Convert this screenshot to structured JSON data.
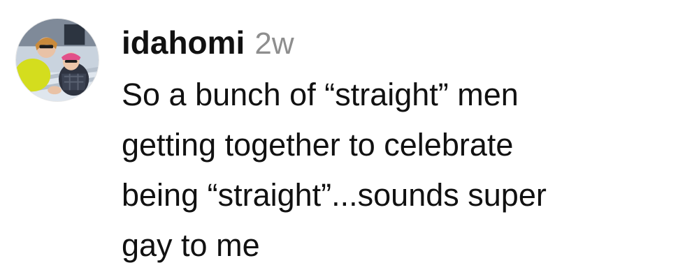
{
  "comment": {
    "username": "idahomi",
    "timestamp": "2w",
    "text_lines": [
      "So a bunch of “straight” men",
      "getting together to celebrate",
      "being “straight”...sounds super",
      "gay to me"
    ]
  },
  "icons": {
    "avatar": "profile-photo"
  },
  "colors": {
    "username": "#111111",
    "timestamp": "#8e8e8e",
    "text": "#111111",
    "background": "#ffffff"
  }
}
